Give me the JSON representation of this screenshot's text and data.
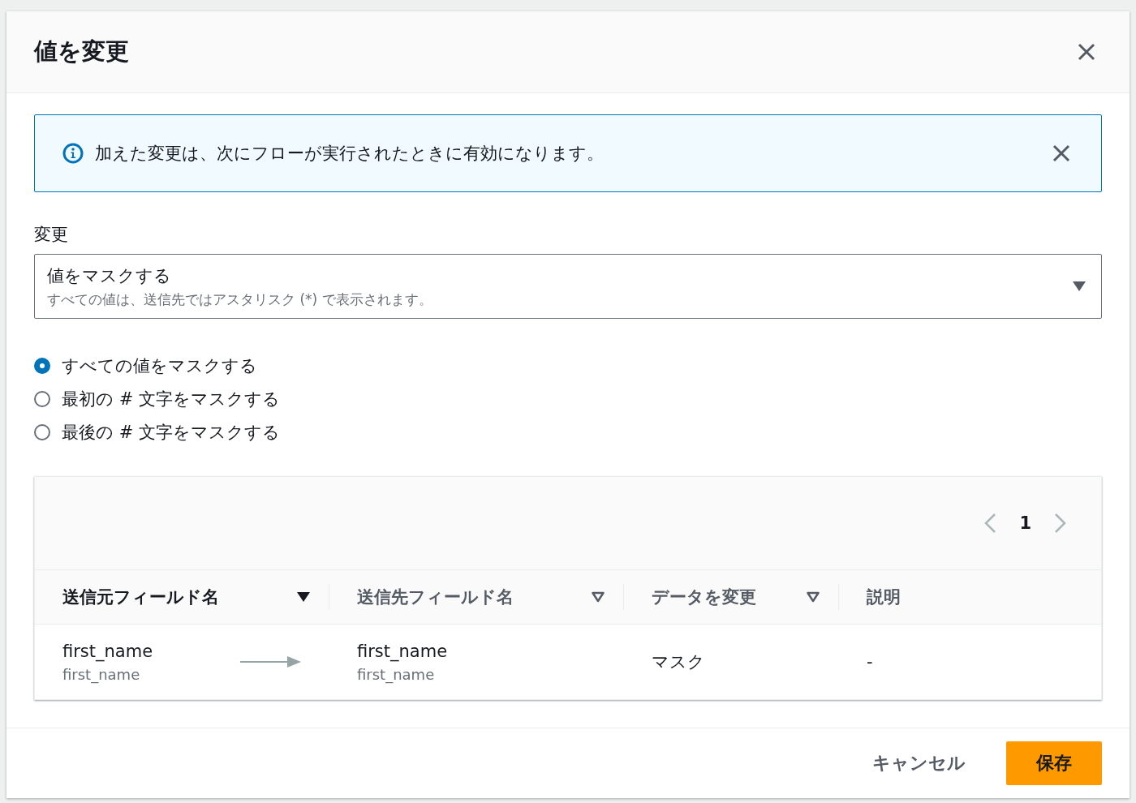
{
  "dialog": {
    "title": "値を変更"
  },
  "alert": {
    "message": "加えた変更は、次にフローが実行されたときに有効になります。"
  },
  "change_field": {
    "label": "変更",
    "value": "値をマスクする",
    "description": "すべての値は、送信先ではアスタリスク (*) で表示されます。"
  },
  "mask_options": [
    {
      "label": "すべての値をマスクする",
      "selected": true
    },
    {
      "label": "最初の # 文字をマスクする",
      "selected": false
    },
    {
      "label": "最後の # 文字をマスクする",
      "selected": false
    }
  ],
  "pagination": {
    "prev_disabled": true,
    "next_disabled": true,
    "pages": [
      {
        "label": "1",
        "selected": true
      }
    ]
  },
  "table": {
    "columns": [
      {
        "label": "送信元フィールド名",
        "sortable": true,
        "sorted": true
      },
      {
        "label": "送信先フィールド名",
        "sortable": true,
        "sorted": false
      },
      {
        "label": "データを変更",
        "sortable": true,
        "sorted": false
      },
      {
        "label": "説明",
        "sortable": false,
        "sorted": false
      }
    ],
    "rows": [
      {
        "source": {
          "name": "first_name",
          "sub": "first_name"
        },
        "target": {
          "name": "first_name",
          "sub": "first_name"
        },
        "change": "マスク",
        "description": "-"
      }
    ]
  },
  "footer": {
    "buttons": [
      {
        "label": "キャンセル",
        "kind": "link"
      },
      {
        "label": "保存",
        "kind": "primary"
      }
    ]
  }
}
